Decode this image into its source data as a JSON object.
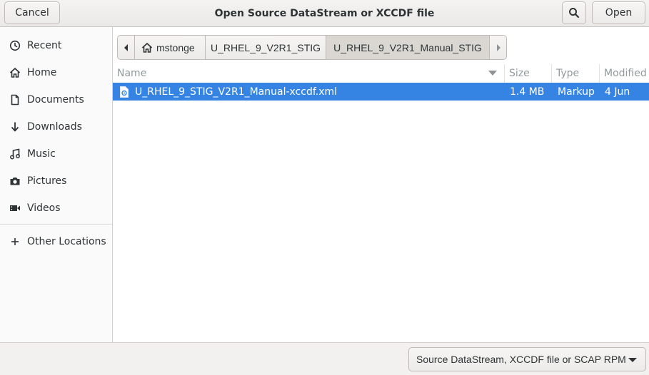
{
  "header": {
    "cancel_label": "Cancel",
    "title": "Open Source DataStream or XCCDF file",
    "open_label": "Open"
  },
  "sidebar": {
    "items": [
      {
        "label": "Recent",
        "icon": "clock-icon"
      },
      {
        "label": "Home",
        "icon": "home-icon"
      },
      {
        "label": "Documents",
        "icon": "document-icon"
      },
      {
        "label": "Downloads",
        "icon": "download-icon"
      },
      {
        "label": "Music",
        "icon": "music-icon"
      },
      {
        "label": "Pictures",
        "icon": "camera-icon"
      },
      {
        "label": "Videos",
        "icon": "video-icon"
      },
      {
        "label": "Other Locations",
        "icon": "plus-icon"
      }
    ]
  },
  "pathbar": {
    "segments": [
      "mstonge",
      "U_RHEL_9_V2R1_STIG",
      "U_RHEL_9_V2R1_Manual_STIG"
    ]
  },
  "filelist": {
    "columns": [
      "Name",
      "Size",
      "Type",
      "Modified"
    ],
    "rows": [
      {
        "name": "U_RHEL_9_STIG_V2R1_Manual-xccdf.xml",
        "size": "1.4 MB",
        "type": "Markup",
        "modified": "4 Jun"
      }
    ]
  },
  "filter": {
    "selected": "Source DataStream, XCCDF file or SCAP RPM"
  },
  "colors": {
    "selection": "#3584e4",
    "header_bg": "#ebe9e7",
    "sidebar_bg": "#fafafa"
  }
}
